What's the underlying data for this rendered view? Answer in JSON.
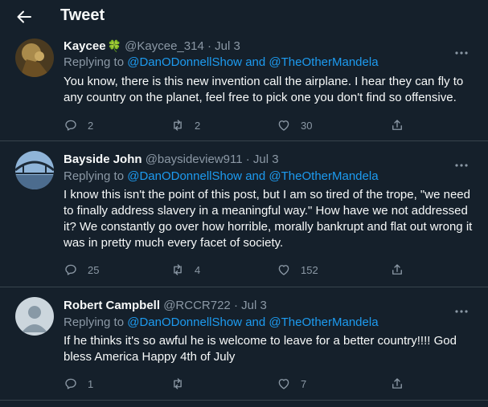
{
  "header": {
    "title": "Tweet"
  },
  "tweets": [
    {
      "name": "Kaycee",
      "name_emoji": "🍀",
      "handle": "@Kaycee_314",
      "separator": "·",
      "date": "Jul 3",
      "replying_prefix": "Replying to",
      "replying_user1": "@DanODonnellShow",
      "replying_and": "and",
      "replying_user2": "@TheOtherMandela",
      "text": "You know, there is this new invention call the airplane. I hear they can fly to any country on the planet, feel free to pick one you don't find so offensive.",
      "replies": "2",
      "retweets": "2",
      "likes": "30"
    },
    {
      "name": "Bayside John",
      "handle": "@baysideview911",
      "separator": "·",
      "date": "Jul 3",
      "replying_prefix": "Replying to",
      "replying_user1": "@DanODonnellShow",
      "replying_and": "and",
      "replying_user2": "@TheOtherMandela",
      "text": "I know this isn't the point of this post, but I am so tired of the trope, \"we need to finally address slavery in a meaningful way.\" How have we not addressed it? We constantly go over how horrible, morally bankrupt and flat out wrong it was in pretty much every facet of society.",
      "replies": "25",
      "retweets": "4",
      "likes": "152"
    },
    {
      "name": "Robert Campbell",
      "handle": "@RCCR722",
      "separator": "·",
      "date": "Jul 3",
      "replying_prefix": "Replying to",
      "replying_user1": "@DanODonnellShow",
      "replying_and": "and",
      "replying_user2": "@TheOtherMandela",
      "text": "If he thinks it's so awful he is welcome to leave for a better country!!!! God bless America Happy 4th of July",
      "replies": "1",
      "retweets": "",
      "likes": "7"
    }
  ],
  "colors": {
    "background": "#15202b",
    "link": "#1d9bf0",
    "muted": "#8b98a5",
    "text": "#f7f9f9",
    "divider": "#38444d"
  },
  "icons": {
    "back": "arrow-left-icon",
    "more": "more-dots-icon",
    "reply": "reply-icon",
    "retweet": "retweet-icon",
    "like": "heart-icon",
    "share": "share-icon"
  }
}
